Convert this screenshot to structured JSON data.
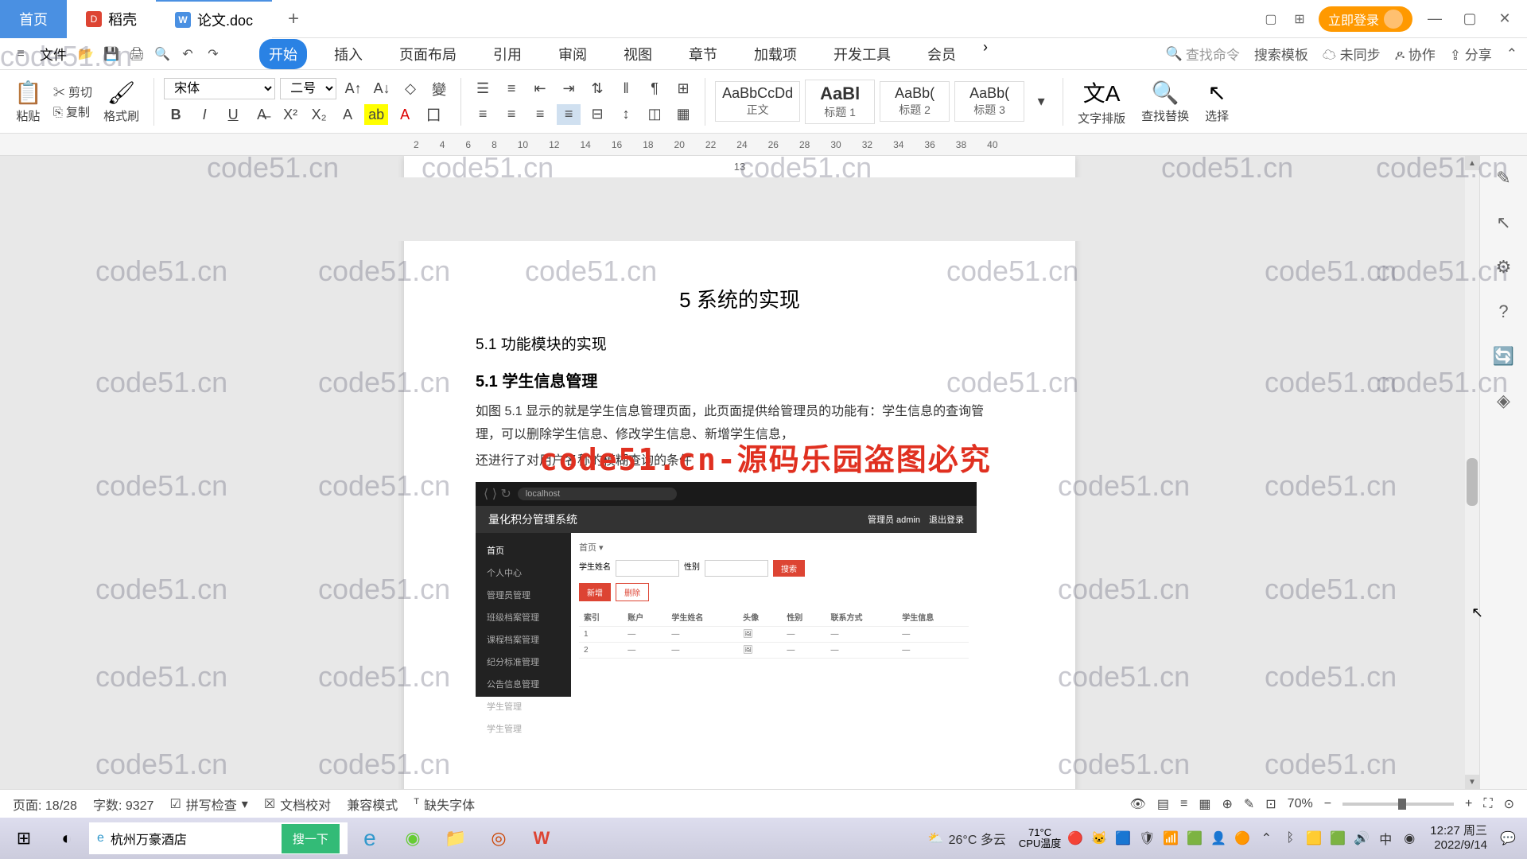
{
  "tabs": {
    "home": "首页",
    "docshell": "稻壳",
    "active": "论文.doc"
  },
  "titleRight": {
    "login": "立即登录"
  },
  "menu": {
    "file": "文件",
    "tabs": [
      "开始",
      "插入",
      "页面布局",
      "引用",
      "审阅",
      "视图",
      "章节",
      "加载项",
      "开发工具",
      "会员"
    ],
    "searchCmd": "查找命令",
    "searchTpl": "搜索模板",
    "unsync": "未同步",
    "collab": "协作",
    "share": "分享"
  },
  "ribbon": {
    "paste": "粘贴",
    "cut": "剪切",
    "copy": "复制",
    "formatBrush": "格式刷",
    "font": "宋体",
    "size": "二号",
    "styles": [
      {
        "preview": "AaBbCcDd",
        "name": "正文"
      },
      {
        "preview": "AaBl",
        "name": "标题 1"
      },
      {
        "preview": "AaBb(",
        "name": "标题 2"
      },
      {
        "preview": "AaBb(",
        "name": "标题 3"
      }
    ],
    "textLayout": "文字排版",
    "findReplace": "查找替换",
    "select": "选择"
  },
  "ruler": [
    "2",
    "4",
    "6",
    "8",
    "10",
    "12",
    "14",
    "16",
    "18",
    "20",
    "22",
    "24",
    "26",
    "28",
    "30",
    "32",
    "34",
    "36",
    "38",
    "40"
  ],
  "doc": {
    "pageNumTop": "13",
    "h1": "5  系统的实现",
    "h2": "5.1  功能模块的实现",
    "h3": "5.1  学生信息管理",
    "p1": "如图 5.1 显示的就是学生信息管理页面，此页面提供给管理员的功能有：学生信息的查询管理，可以删除学生信息、修改学生信息、新增学生信息，",
    "p2": "还进行了对用户名称的模糊查询的条件",
    "watermark": "code51.cn-源码乐园盗图必究",
    "embed": {
      "addr": "localhost",
      "title": "量化积分管理系统",
      "userLabel": "管理员 admin",
      "logout": "退出登录",
      "side": [
        "首页",
        "个人中心",
        "管理员管理",
        "班级档案管理",
        "课程档案管理",
        "纪分标准管理",
        "公告信息管理",
        "学生管理",
        "学生管理"
      ],
      "crumb": "首页",
      "searchLabel1": "学生姓名",
      "searchLabel2": "性别",
      "btnSearch": "搜索",
      "btnAdd": "新增",
      "btnDel": "删除",
      "cols": [
        "索引",
        "账户",
        "学生姓名",
        "头像",
        "性别",
        "联系方式",
        "学生信息"
      ]
    }
  },
  "status": {
    "page": "页面: 18/28",
    "words": "字数: 9327",
    "spell": "拼写检查",
    "proof": "文档校对",
    "compat": "兼容模式",
    "missing": "缺失字体",
    "zoom": "70%"
  },
  "taskbar": {
    "searchValue": "杭州万豪酒店",
    "searchBtn": "搜一下",
    "weather": "26°C 多云",
    "temp": "71°C",
    "tempLabel": "CPU温度",
    "ime": "中",
    "time": "12:27 周三",
    "date": "2022/9/14"
  },
  "watermarkText": "code51.cn"
}
